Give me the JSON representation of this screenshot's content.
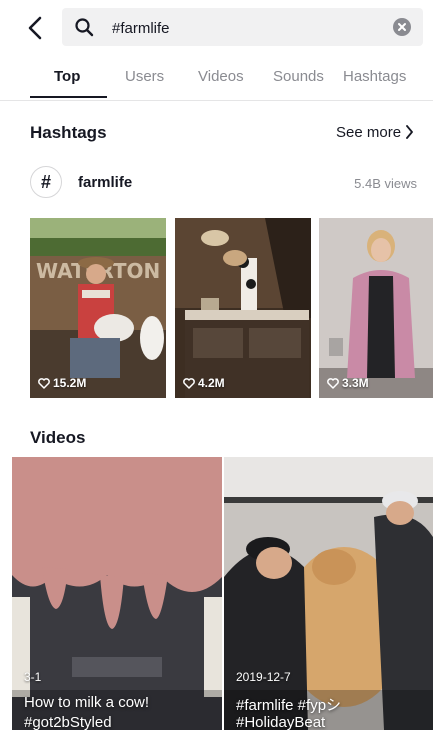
{
  "search": {
    "value": "#farmlife",
    "placeholder": ""
  },
  "tabs": [
    {
      "label": "Top",
      "active": true
    },
    {
      "label": "Users",
      "active": false
    },
    {
      "label": "Videos",
      "active": false
    },
    {
      "label": "Sounds",
      "active": false
    },
    {
      "label": "Hashtags",
      "active": false
    }
  ],
  "hashtags_section": {
    "title": "Hashtags",
    "see_more": "See more",
    "hashtag": {
      "symbol": "#",
      "name": "farmlife",
      "views": "5.4B views"
    },
    "thumbnails": [
      {
        "likes": "15.2M",
        "sign_text": "WATERTON FORGE"
      },
      {
        "likes": "4.2M"
      },
      {
        "likes": "3.3M"
      }
    ]
  },
  "videos_section": {
    "title": "Videos",
    "items": [
      {
        "date": "3-1",
        "caption_line1": "How to milk a cow!",
        "caption_line2": "#got2bStyled"
      },
      {
        "date": "2019-12-7",
        "caption_line1": "#farmlife #fypシ",
        "caption_line2": "#HolidayBeat"
      }
    ]
  },
  "colors": {
    "text": "#161823",
    "muted": "#8a8b91",
    "search_bg": "#f1f1f2",
    "divider": "#e5e5e6"
  },
  "icons": [
    "back-arrow-icon",
    "search-icon",
    "clear-icon",
    "hashtag-icon",
    "chevron-right-icon",
    "heart-icon"
  ]
}
